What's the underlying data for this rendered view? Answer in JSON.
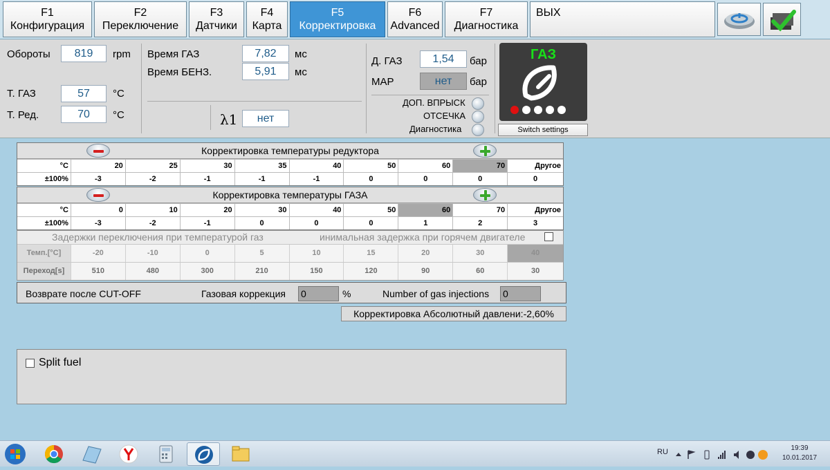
{
  "tabs": [
    {
      "key": "F1",
      "label": "Конфигурация"
    },
    {
      "key": "F2",
      "label": "Переключение"
    },
    {
      "key": "F3",
      "label": "Датчики"
    },
    {
      "key": "F4",
      "label": "Карта"
    },
    {
      "key": "F5",
      "label": "Корректировка"
    },
    {
      "key": "F6",
      "label": "Advanced"
    },
    {
      "key": "F7",
      "label": "Диагностика"
    }
  ],
  "exit_label": "ВЫХ",
  "status": {
    "rpm_label": "Обороты",
    "rpm_value": "819",
    "rpm_unit": "rpm",
    "tgas_label": "Т. ГАЗ",
    "tgas_value": "57",
    "tgas_unit": "°C",
    "tred_label": "Т. Ред.",
    "tred_value": "70",
    "tred_unit": "°C",
    "gas_time_label": "Время ГАЗ",
    "gas_time_value": "7,82",
    "gas_time_unit": "мс",
    "benz_time_label": "Время БЕНЗ.",
    "benz_time_value": "5,91",
    "benz_time_unit": "мс",
    "lambda_label": "λ1",
    "lambda_value": "нет",
    "dgas_label": "Д. ГАЗ",
    "dgas_value": "1,54",
    "dgas_unit": "бар",
    "map_label": "MAP",
    "map_value": "нет",
    "map_unit": "бар",
    "extra_inj_label": "ДОП. ВПРЫСК",
    "cutoff_label": "ОТСЕЧКА",
    "diag_label": "Диагностика",
    "gas_indicator": "ГАЗ",
    "switch_settings": "Switch settings"
  },
  "reducer_table": {
    "title": "Корректировка температуры редуктора",
    "row1_label": "°C",
    "row1": [
      "20",
      "25",
      "30",
      "35",
      "40",
      "50",
      "60",
      "70",
      "Другое"
    ],
    "row2_label": "±100%",
    "row2": [
      "-3",
      "-2",
      "-1",
      "-1",
      "-1",
      "0",
      "0",
      "0",
      "0"
    ]
  },
  "gas_table": {
    "title": "Корректировка температуры ГАЗА",
    "row1_label": "°C",
    "row1": [
      "0",
      "10",
      "20",
      "30",
      "40",
      "50",
      "60",
      "70",
      "Другое"
    ],
    "row2_label": "±100%",
    "row2": [
      "-3",
      "-2",
      "-1",
      "0",
      "0",
      "0",
      "1",
      "2",
      "3"
    ]
  },
  "delay_table": {
    "title_left": "Задержки переключения при температурой газ",
    "title_right": "инимальная задержка при горячем двигателе",
    "row1_label": "Темп.[°C]",
    "row1": [
      "-20",
      "-10",
      "0",
      "5",
      "10",
      "15",
      "20",
      "30",
      "40"
    ],
    "row2_label": "Переход[s]",
    "row2": [
      "510",
      "480",
      "300",
      "210",
      "150",
      "120",
      "90",
      "60",
      "30"
    ]
  },
  "cutoff": {
    "return_label": "Возврате после CUT-OFF",
    "gas_corr_label": "Газовая коррекция",
    "gas_corr_value": "0",
    "percent": "%",
    "injections_label": "Number of gas injections",
    "injections_value": "0"
  },
  "abs_pressure": "Корректировка Абсолютный давлени:-2,60%",
  "split_fuel_label": "Split fuel",
  "taskbar": {
    "lang": "RU",
    "time": "19:39",
    "date": "10.01.2017"
  }
}
